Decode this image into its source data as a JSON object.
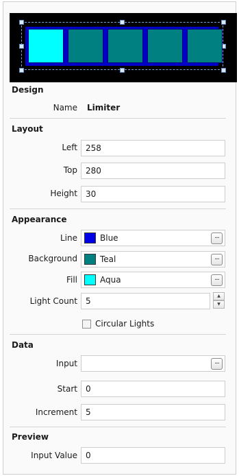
{
  "sections": {
    "design": {
      "title": "Design",
      "name_label": "Name",
      "name_value": "Limiter"
    },
    "layout": {
      "title": "Layout",
      "fields": [
        {
          "label": "Left",
          "value": "258"
        },
        {
          "label": "Top",
          "value": "280"
        },
        {
          "label": "Height",
          "value": "30"
        }
      ]
    },
    "appearance": {
      "title": "Appearance",
      "colors": [
        {
          "label": "Line",
          "value": "Blue",
          "swatch": "#0000e6"
        },
        {
          "label": "Background",
          "value": "Teal",
          "swatch": "#008080"
        },
        {
          "label": "Fill",
          "value": "Aqua",
          "swatch": "#00ffff"
        }
      ],
      "light_count_label": "Light Count",
      "light_count_value": "5",
      "circular_lights_label": "Circular Lights",
      "circular_lights_checked": false
    },
    "data": {
      "title": "Data",
      "input_label": "Input",
      "input_value": "",
      "start_label": "Start",
      "start_value": "0",
      "increment_label": "Increment",
      "increment_value": "5"
    },
    "preview": {
      "title": "Preview",
      "input_value_label": "Input Value",
      "input_value": "0"
    }
  },
  "limiter_preview": {
    "lit_count": 1,
    "total": 5,
    "lit_color": "#00ffff",
    "unlit_color": "#008080",
    "line_color": "#0000c8"
  },
  "icons": {
    "ellipsis": "ellipsis-button",
    "spin_up": "spin-up-arrow",
    "spin_down": "spin-down-arrow"
  },
  "ui": {
    "ellipsis_text": "...",
    "spin_up_glyph": "▲",
    "spin_down_glyph": "▼"
  }
}
